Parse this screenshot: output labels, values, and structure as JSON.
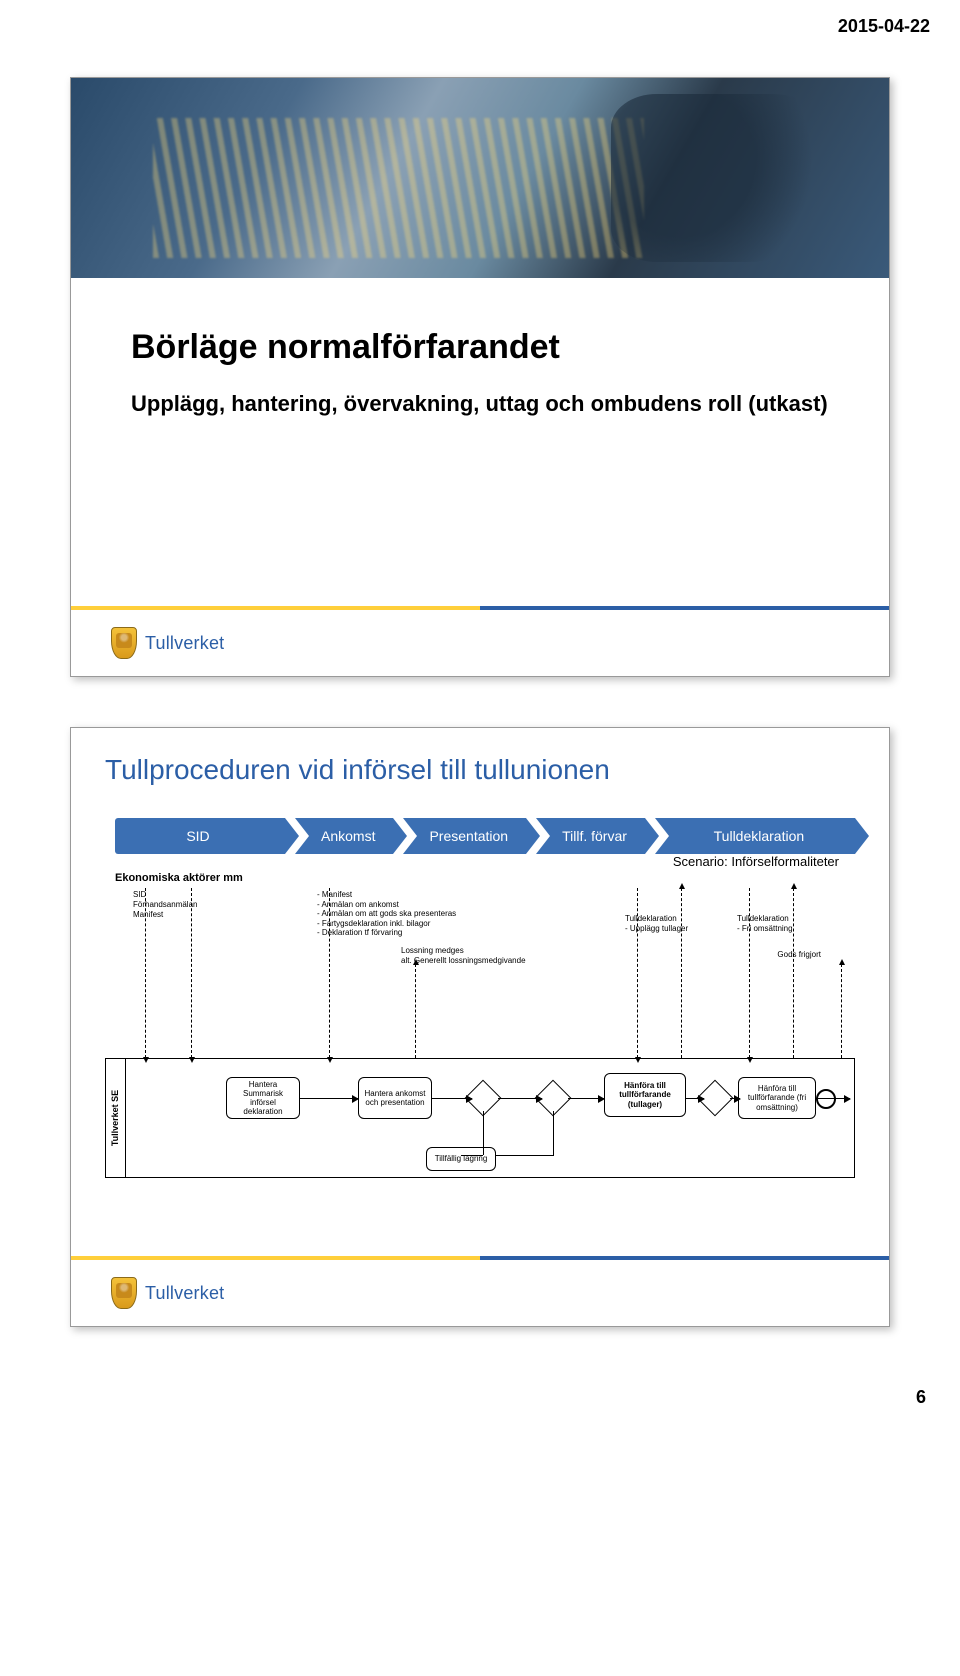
{
  "page": {
    "date": "2015-04-22",
    "number": "6"
  },
  "slide1": {
    "title": "Börläge normalförfarandet",
    "subtitle": "Upplägg, hantering, övervakning, uttag och ombudens roll (utkast)",
    "logo_text": "Tullverket"
  },
  "slide2": {
    "title": "Tullproceduren vid införsel till tullunionen",
    "chevrons": {
      "sid": "SID",
      "ankomst": "Ankomst",
      "presentation": "Presentation",
      "tillf": "Tillf. förvar",
      "tulldek": "Tulldeklaration"
    },
    "scenario": "Scenario: Införselformaliteter",
    "ekon_label": "Ekonomiska aktörer mm",
    "sid_stack": {
      "l1": "SID",
      "l2": "Förhandsanmälan",
      "l3": "Manifest"
    },
    "manifest_stack": {
      "l1": "- Manifest",
      "l2": "- Anmälan om ankomst",
      "l3": "- Anmälan om att gods ska presenteras",
      "l4": "- Fartygsdeklaration inkl. bilagor",
      "l5": "- Deklaration tf förvaring"
    },
    "lossning": {
      "l1": "Lossning medges",
      "l2": "alt. Generellt lossningsmedgivande"
    },
    "tulldek_left": {
      "l1": "Tulldeklaration",
      "l2": "- Upplägg tullager"
    },
    "tulldek_right": {
      "l1": "Tulldeklaration",
      "l2": "- Fri omsättning"
    },
    "gods": "Gods frigjort",
    "lane_label": "Tullverket SE",
    "proc1": "Hantera Summarisk införsel deklaration",
    "proc2": "Hantera ankomst och presentation",
    "proc3": "Hänföra till tullförfarande (tullager)",
    "proc4": "Hänföra till tullförfarande (fri omsättning)",
    "proc_tillf": "Tillfällig lagring",
    "logo_text": "Tullverket"
  }
}
